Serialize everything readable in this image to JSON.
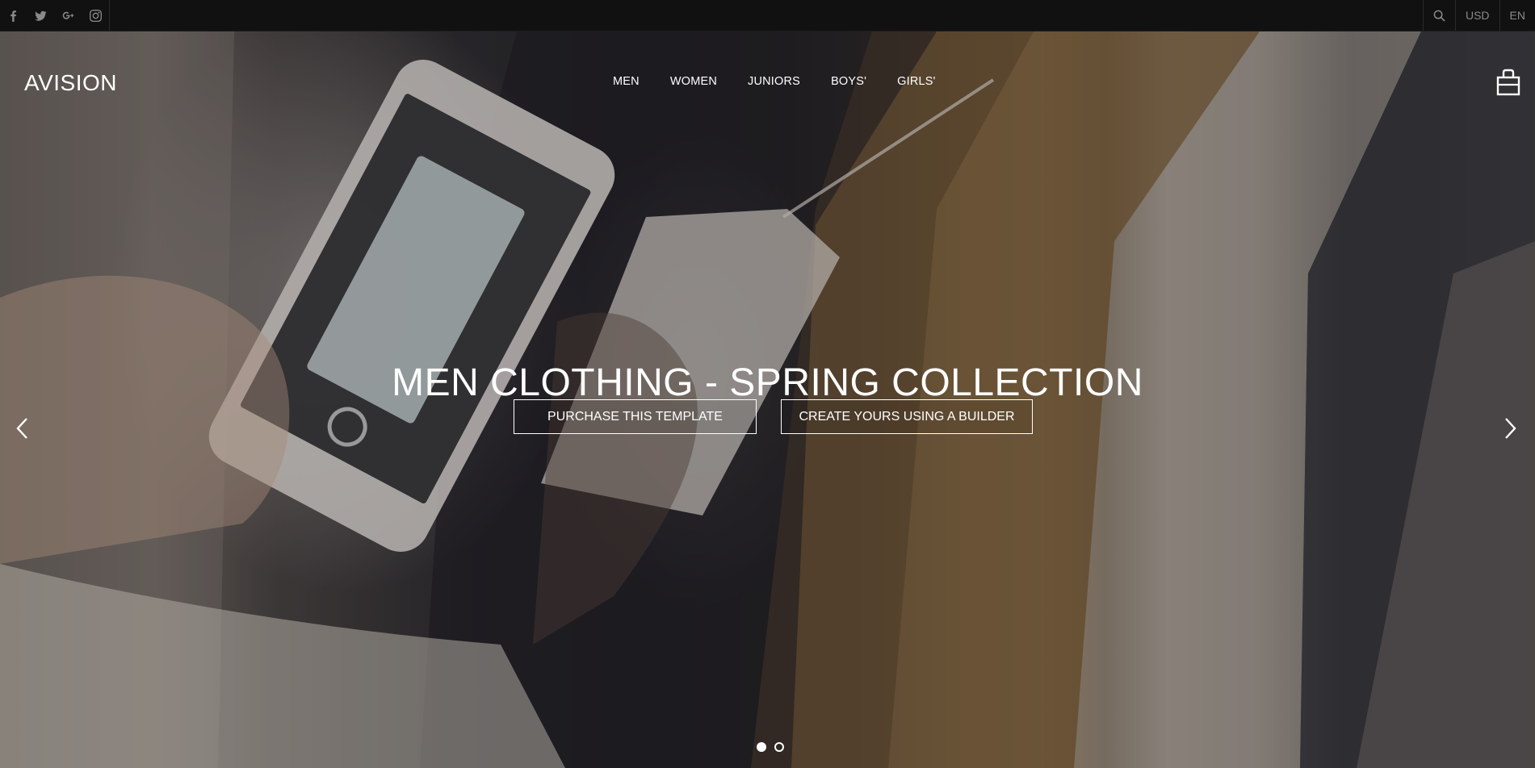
{
  "topbar": {
    "social": [
      {
        "icon": "facebook-icon"
      },
      {
        "icon": "twitter-icon"
      },
      {
        "icon": "google-plus-icon"
      },
      {
        "icon": "instagram-icon"
      }
    ],
    "search_icon": "search-icon",
    "currency": "USD",
    "language": "EN"
  },
  "header": {
    "brand": "AVISION",
    "nav": [
      "MEN",
      "WOMEN",
      "JUNIORS",
      "BOYS'",
      "GIRLS'"
    ],
    "cart_icon": "shopping-bag-icon"
  },
  "hero": {
    "title": "MEN CLOTHING - SPRING COLLECTION",
    "purchase_label": "PURCHASE THIS TEMPLATE",
    "builder_label": "CREATE YOURS USING A BUILDER",
    "slides_total": 2,
    "active_slide": 1
  },
  "colors": {
    "topbar_bg": "#111111",
    "text_on_hero": "#ffffff",
    "topbar_icon": "#8a8a8a"
  }
}
